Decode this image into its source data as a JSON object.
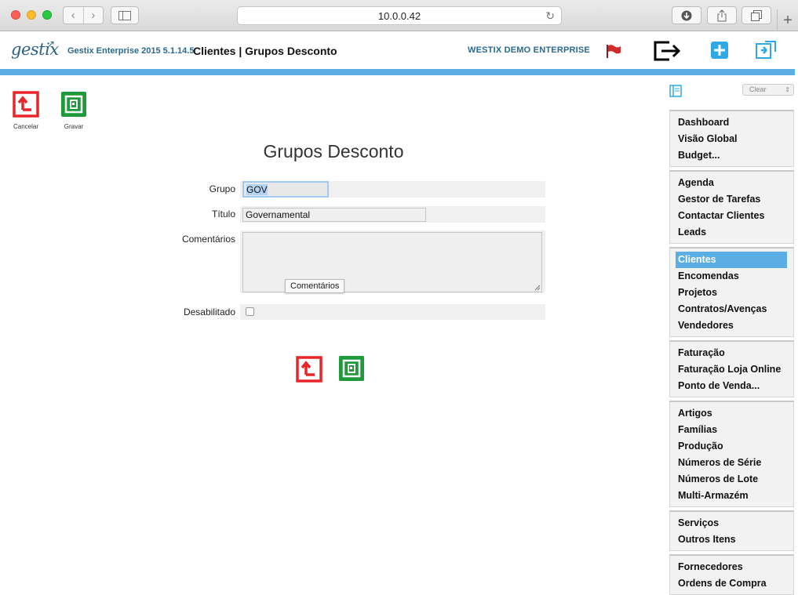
{
  "browser": {
    "url": "10.0.0.42"
  },
  "header": {
    "logo": "gestix",
    "version": "Gestix Enterprise 2015 5.1.14.5",
    "crumb": "Clientes | Grupos Desconto",
    "company": "WESTIX DEMO ENTERPRISE"
  },
  "actions": {
    "cancel_label": "Cancelar",
    "save_label": "Gravar"
  },
  "form": {
    "title": "Grupos Desconto",
    "group_label": "Grupo",
    "group_value": "GOV",
    "title_label": "Título",
    "title_value": "Governamental",
    "comments_label": "Comentários",
    "comments_value": "",
    "comments_tooltip": "Comentários",
    "disabled_label": "Desabilitado",
    "disabled_checked": false
  },
  "sidebar": {
    "clear_select": "Clear",
    "groups": [
      [
        "Dashboard",
        "Visão Global",
        "Budget..."
      ],
      [
        "Agenda",
        "Gestor de Tarefas",
        "Contactar Clientes",
        "Leads"
      ],
      [
        "Clientes",
        "Encomendas",
        "Projetos",
        "Contratos/Avenças",
        "Vendedores"
      ],
      [
        "Faturação",
        "Faturação Loja Online",
        "Ponto de Venda..."
      ],
      [
        "Artigos",
        "Famílias",
        "Produção",
        "Números de Série",
        "Números de Lote",
        "Multi-Armazém"
      ],
      [
        "Serviços",
        "Outros Itens"
      ],
      [
        "Fornecedores",
        "Ordens de Compra"
      ]
    ],
    "active_item": "Clientes"
  },
  "colors": {
    "accent": "#5aaee4",
    "cancel_red": "#e8262a",
    "save_green": "#1e9a3a"
  },
  "icons": {
    "logout": "logout-icon",
    "add": "add-icon",
    "sync": "sync-icon",
    "flag": "flag-icon"
  }
}
